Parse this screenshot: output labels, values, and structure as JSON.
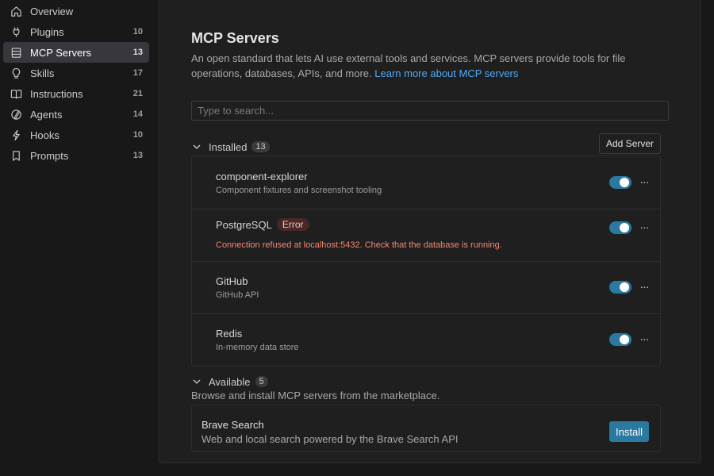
{
  "sidebar": {
    "items": [
      {
        "label": "Overview",
        "count": "",
        "icon": "home-icon"
      },
      {
        "label": "Plugins",
        "count": "10",
        "icon": "plug-icon"
      },
      {
        "label": "MCP Servers",
        "count": "13",
        "icon": "server-icon"
      },
      {
        "label": "Skills",
        "count": "17",
        "icon": "lightbulb-icon"
      },
      {
        "label": "Instructions",
        "count": "21",
        "icon": "book-icon"
      },
      {
        "label": "Agents",
        "count": "14",
        "icon": "agent-icon"
      },
      {
        "label": "Hooks",
        "count": "10",
        "icon": "lightning-icon"
      },
      {
        "label": "Prompts",
        "count": "13",
        "icon": "bookmark-icon"
      }
    ],
    "active_index": 2
  },
  "main": {
    "title": "MCP Servers",
    "description": "An open standard that lets AI use external tools and services. MCP servers provide tools for file operations, databases, APIs, and more.",
    "learn_more": "Learn more about MCP servers",
    "search_placeholder": "Type to search...",
    "add_server_label": "Add Server",
    "installed": {
      "title": "Installed",
      "count": "13",
      "servers": [
        {
          "name": "component-explorer",
          "description": "Component fixtures and screenshot tooling",
          "enabled": true
        },
        {
          "name": "PostgreSQL",
          "badge": "Error",
          "error": "Connection refused at localhost:5432. Check that the database is running.",
          "enabled": true
        },
        {
          "name": "GitHub",
          "description": "GitHub API",
          "enabled": true
        },
        {
          "name": "Redis",
          "description": "In-memory data store",
          "enabled": true
        }
      ]
    },
    "available": {
      "title": "Available",
      "count": "5",
      "description": "Browse and install MCP servers from the marketplace.",
      "servers": [
        {
          "name": "Brave Search",
          "description": "Web and local search powered by the Brave Search API",
          "action": "Install"
        }
      ]
    }
  },
  "colors": {
    "accent": "#2b79a0",
    "link": "#4daafc",
    "error": "#f48771"
  }
}
